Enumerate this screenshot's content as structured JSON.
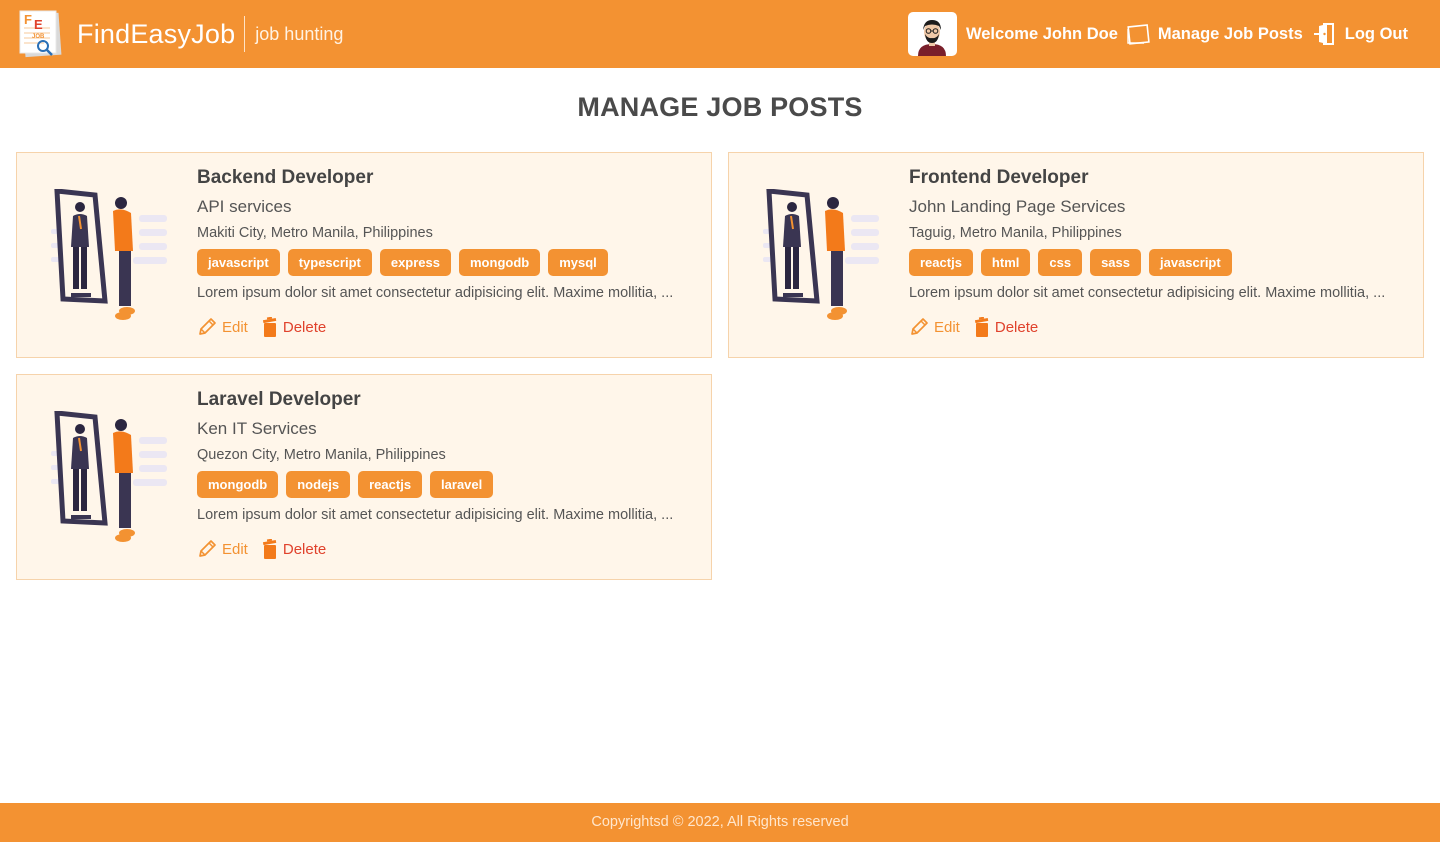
{
  "header": {
    "logo_text": "FE JOB",
    "brand": "FindEasyJob",
    "tagline": "job hunting",
    "welcome": "Welcome John Doe",
    "manage_label": "Manage Job Posts",
    "logout_label": "Log Out"
  },
  "page": {
    "title": "MANAGE JOB POSTS"
  },
  "jobs": [
    {
      "title": "Backend Developer",
      "company": "API services",
      "location": "Makiti City, Metro Manila, Philippines",
      "tags": [
        "javascript",
        "typescript",
        "express",
        "mongodb",
        "mysql"
      ],
      "description": "Lorem ipsum dolor sit amet consectetur adipisicing elit. Maxime mollitia, ...",
      "edit_label": "Edit",
      "delete_label": "Delete"
    },
    {
      "title": "Frontend Developer",
      "company": "John Landing Page Services",
      "location": "Taguig, Metro Manila, Philippines",
      "tags": [
        "reactjs",
        "html",
        "css",
        "sass",
        "javascript"
      ],
      "description": "Lorem ipsum dolor sit amet consectetur adipisicing elit. Maxime mollitia, ...",
      "edit_label": "Edit",
      "delete_label": "Delete"
    },
    {
      "title": "Laravel Developer",
      "company": "Ken IT Services",
      "location": "Quezon City, Metro Manila, Philippines",
      "tags": [
        "mongodb",
        "nodejs",
        "reactjs",
        "laravel"
      ],
      "description": "Lorem ipsum dolor sit amet consectetur adipisicing elit. Maxime mollitia, ...",
      "edit_label": "Edit",
      "delete_label": "Delete"
    }
  ],
  "footer": {
    "copyright": "Copyrightsd © 2022, All Rights reserved"
  },
  "colors": {
    "brand_orange": "#f39232",
    "card_bg": "#fff6ea",
    "delete_red": "#e0422c"
  },
  "icons": {
    "logo": "fe-job-logo-icon",
    "avatar": "user-avatar-icon",
    "manage": "document-icon",
    "logout": "door-exit-icon",
    "edit": "pencil-icon",
    "delete": "trash-icon",
    "illustration": "mirror-person-illustration"
  }
}
